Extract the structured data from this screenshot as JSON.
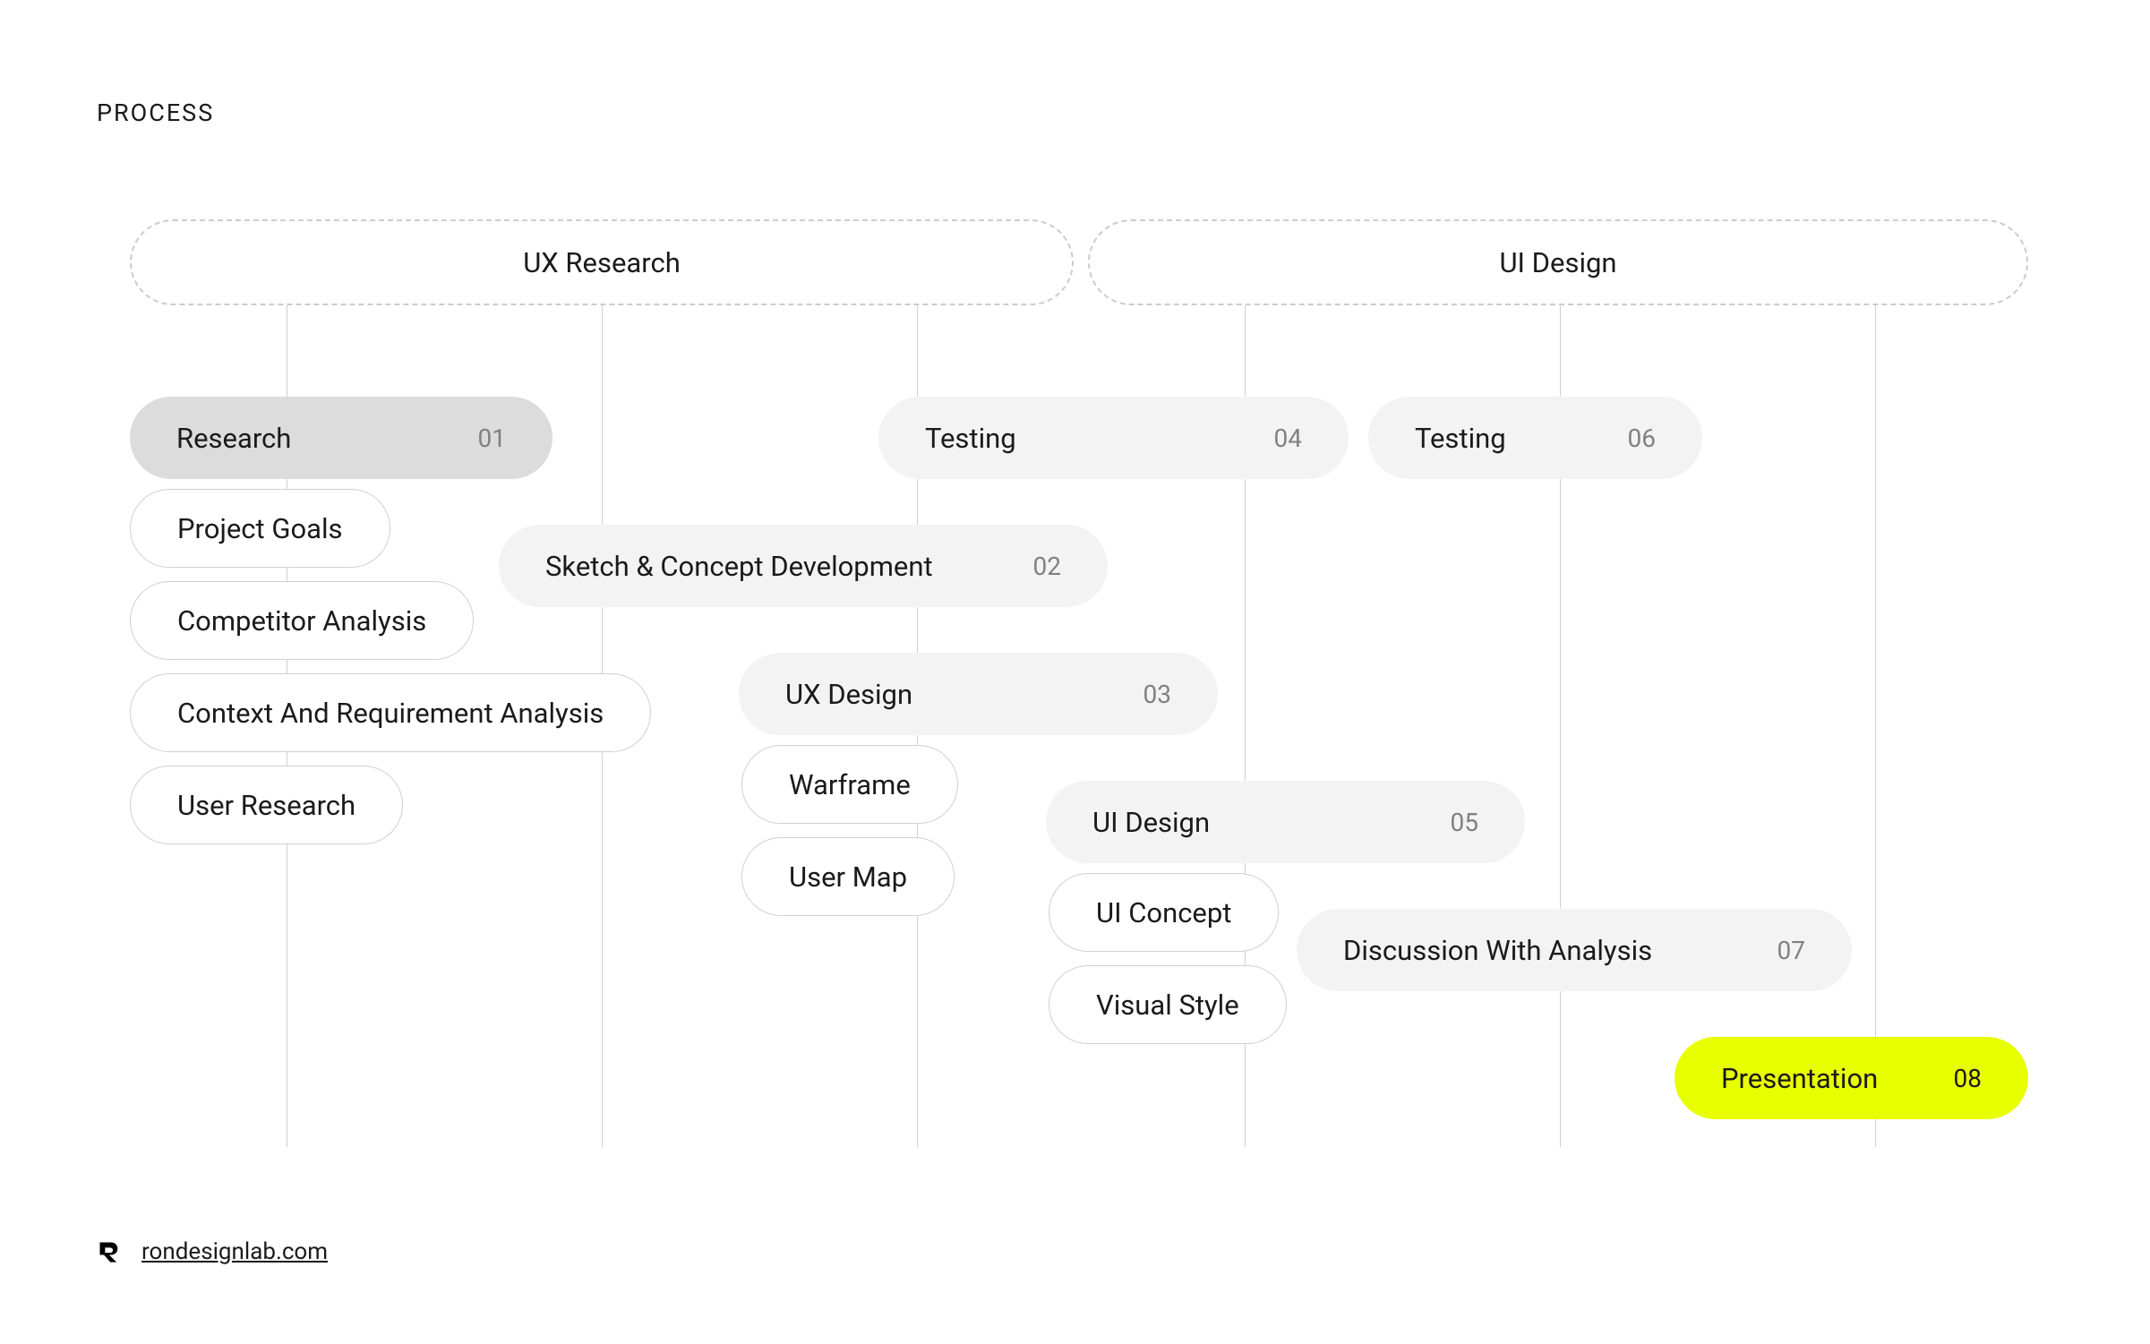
{
  "page": {
    "title": "PROCESS"
  },
  "categories": {
    "ux": "UX Research",
    "ui": "UI Design"
  },
  "stages": {
    "research": {
      "label": "Research",
      "num": "01"
    },
    "sketch": {
      "label": "Sketch & Concept Development",
      "num": "02"
    },
    "ux_design": {
      "label": "UX Design",
      "num": "03"
    },
    "testing1": {
      "label": "Testing",
      "num": "04"
    },
    "ui_design": {
      "label": "UI Design",
      "num": "05"
    },
    "testing2": {
      "label": "Testing",
      "num": "06"
    },
    "discussion": {
      "label": "Discussion With Analysis",
      "num": "07"
    },
    "presentation": {
      "label": "Presentation",
      "num": "08"
    }
  },
  "substages": {
    "project_goals": "Project Goals",
    "competitor_analysis": "Competitor Analysis",
    "context_req": "Context And Requirement Analysis",
    "user_research": "User Research",
    "warframe": "Warframe",
    "user_map": "User Map",
    "ui_concept": "UI Concept",
    "visual_style": "Visual Style"
  },
  "footer": {
    "link": "rondesignlab.com"
  }
}
